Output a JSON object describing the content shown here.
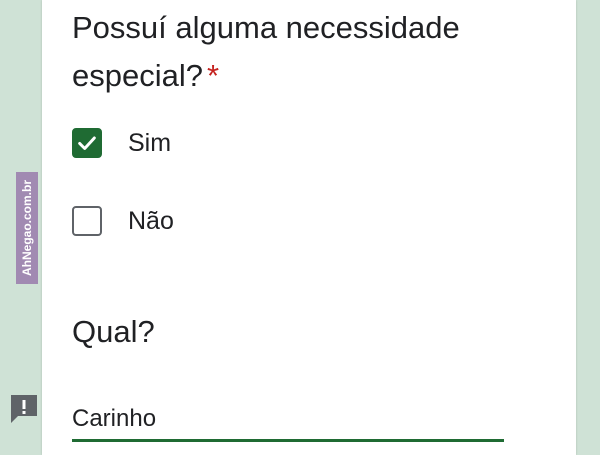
{
  "form": {
    "question": "Possuí alguma necessidade especial?",
    "required_marker": "*",
    "options": [
      {
        "label": "Sim",
        "checked": true
      },
      {
        "label": "Não",
        "checked": false
      }
    ],
    "followup_question": "Qual?",
    "followup_answer": "Carinho"
  },
  "watermark": {
    "text": "AhNegao.com.br"
  },
  "icons": {
    "checkmark": "check-icon",
    "report": "report-issue-icon"
  },
  "colors": {
    "accent": "#1f6b33",
    "required": "#c5221f",
    "background": "#cfe2d6",
    "watermark_bg": "#a18ab2"
  }
}
